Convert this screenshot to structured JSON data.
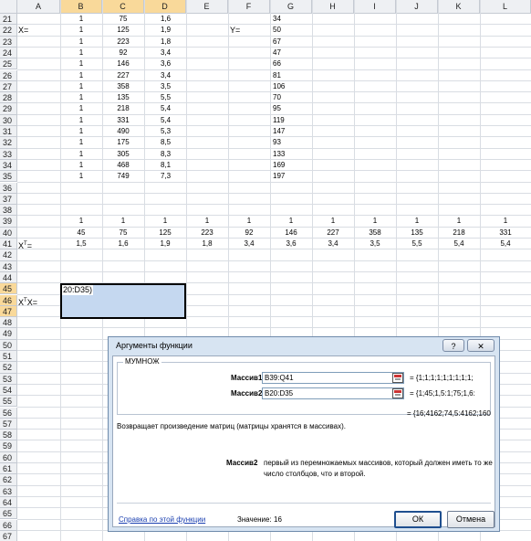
{
  "columns": [
    "A",
    "B",
    "C",
    "D",
    "E",
    "F",
    "G",
    "H",
    "I",
    "J",
    "K",
    "L"
  ],
  "selected_columns": [
    "B",
    "C",
    "D"
  ],
  "rows": [
    "21",
    "22",
    "23",
    "24",
    "25",
    "26",
    "27",
    "28",
    "29",
    "30",
    "31",
    "32",
    "33",
    "34",
    "35",
    "36",
    "37",
    "38",
    "39",
    "40",
    "41",
    "42",
    "43",
    "44",
    "45",
    "46",
    "47",
    "48",
    "49",
    "50",
    "51",
    "52",
    "53",
    "54",
    "55",
    "56",
    "57",
    "58",
    "59",
    "60",
    "61",
    "62",
    "63",
    "64",
    "65",
    "66",
    "67",
    "68"
  ],
  "selected_rows": [
    "45",
    "46",
    "47"
  ],
  "labels": {
    "x_label": "X=",
    "y_label": "Y=",
    "xt_label": "X",
    "xt_sup": "T",
    "xt_eq": "=",
    "xtx_label": "X",
    "xtx_sup": "T",
    "xtx_tail": "X="
  },
  "matrix_x": {
    "col_b": [
      "1",
      "1",
      "1",
      "1",
      "1",
      "1",
      "1",
      "1",
      "1",
      "1",
      "1",
      "1",
      "1",
      "1",
      "1"
    ],
    "col_c": [
      "75",
      "125",
      "223",
      "92",
      "146",
      "227",
      "358",
      "135",
      "218",
      "331",
      "490",
      "175",
      "305",
      "468",
      "749"
    ],
    "col_d": [
      "1,6",
      "1,9",
      "1,8",
      "3,4",
      "3,6",
      "3,4",
      "3,5",
      "5,5",
      "5,4",
      "5,4",
      "5,3",
      "8,5",
      "8,3",
      "8,1",
      "7,3"
    ]
  },
  "matrix_y": [
    "34",
    "50",
    "67",
    "47",
    "66",
    "81",
    "106",
    "70",
    "95",
    "119",
    "147",
    "93",
    "133",
    "169",
    "197"
  ],
  "matrix_xt": {
    "row39": [
      "1",
      "1",
      "1",
      "1",
      "1",
      "1",
      "1",
      "1",
      "1",
      "1",
      "1"
    ],
    "row40": [
      "45",
      "75",
      "125",
      "223",
      "92",
      "146",
      "227",
      "358",
      "135",
      "218",
      "331"
    ],
    "row41": [
      "1,5",
      "1,6",
      "1,9",
      "1,8",
      "3,4",
      "3,6",
      "3,4",
      "3,5",
      "5,5",
      "5,4",
      "5,4"
    ]
  },
  "formula_cell": "20:D35)",
  "dialog": {
    "title": "Аргументы функции",
    "help_btn": "?",
    "close_btn": "✕",
    "function_name": "МУМНОЖ",
    "arg1_label": "Массив1",
    "arg1_value": "B39:Q41",
    "arg1_result": "= {1;1;1;1;1;1;1;1;1;",
    "arg2_label": "Массив2",
    "arg2_value": "B20:D35",
    "arg2_result": "= {1;45;1,5:1;75;1,6:",
    "result": "= {16;4162;74,5:4162;160",
    "description": "Возвращает произведение матриц (матрицы хранятся в массивах).",
    "current_arg_label": "Массив2",
    "current_arg_desc_1": "первый из перемножаемых массивов, который должен иметь то же",
    "current_arg_desc_2": "число столбцов, что и второй.",
    "help_link": "Справка по этой функции",
    "value_label": "Значение:",
    "value": "16",
    "ok": "ОК",
    "cancel": "Отмена"
  }
}
